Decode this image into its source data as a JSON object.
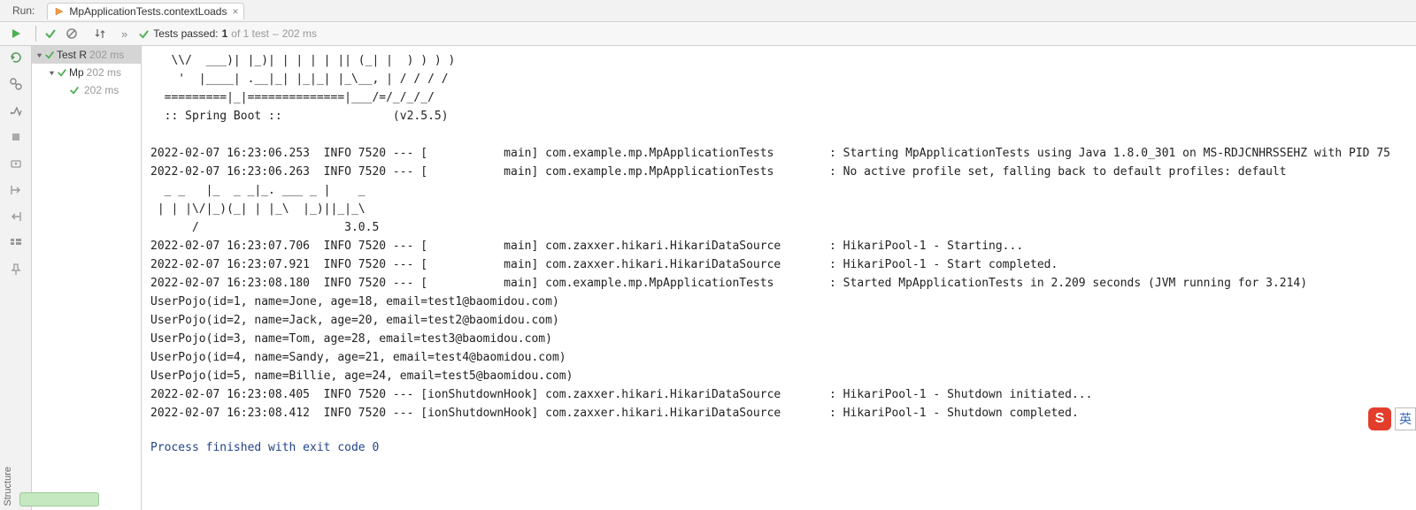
{
  "topbar": {
    "run_label": "Run:",
    "tab": {
      "label": "MpApplicationTests.contextLoads"
    }
  },
  "toolbar": {
    "status_prefix": "Tests passed:",
    "status_count": "1",
    "status_total": "of 1 test",
    "status_sep": "–",
    "status_time": "202 ms"
  },
  "tree": {
    "items": [
      {
        "name": "Test R",
        "time": "202 ms",
        "depth": 0,
        "chev": true,
        "selected": true
      },
      {
        "name": "Mp",
        "time": "202 ms",
        "depth": 1,
        "chev": true,
        "selected": false
      },
      {
        "name": "",
        "time": "202 ms",
        "depth": 2,
        "chev": false,
        "selected": false
      }
    ]
  },
  "ime": {
    "badge": "S",
    "lang": "英"
  },
  "exit_text": "Process finished with exit code 0",
  "console_lines": [
    "   \\\\/  ___)| |_)| | | | | || (_| |  ) ) ) )",
    "    '  |____| .__|_| |_|_| |_\\__, | / / / /",
    "  =========|_|==============|___/=/_/_/_/",
    "  :: Spring Boot ::                (v2.5.5)",
    "",
    "2022-02-07 16:23:06.253  INFO 7520 --- [           main] com.example.mp.MpApplicationTests        : Starting MpApplicationTests using Java 1.8.0_301 on MS-RDJCNHRSSEHZ with PID 75",
    "2022-02-07 16:23:06.263  INFO 7520 --- [           main] com.example.mp.MpApplicationTests        : No active profile set, falling back to default profiles: default",
    "  _ _   |_  _ _|_. ___ _ |    _",
    " | | |\\/|_)(_| | |_\\  |_)||_|_\\",
    "      /                     3.0.5",
    "2022-02-07 16:23:07.706  INFO 7520 --- [           main] com.zaxxer.hikari.HikariDataSource       : HikariPool-1 - Starting...",
    "2022-02-07 16:23:07.921  INFO 7520 --- [           main] com.zaxxer.hikari.HikariDataSource       : HikariPool-1 - Start completed.",
    "2022-02-07 16:23:08.180  INFO 7520 --- [           main] com.example.mp.MpApplicationTests        : Started MpApplicationTests in 2.209 seconds (JVM running for 3.214)",
    "UserPojo(id=1, name=Jone, age=18, email=test1@baomidou.com)",
    "UserPojo(id=2, name=Jack, age=20, email=test2@baomidou.com)",
    "UserPojo(id=3, name=Tom, age=28, email=test3@baomidou.com)",
    "UserPojo(id=4, name=Sandy, age=21, email=test4@baomidou.com)",
    "UserPojo(id=5, name=Billie, age=24, email=test5@baomidou.com)",
    "2022-02-07 16:23:08.405  INFO 7520 --- [ionShutdownHook] com.zaxxer.hikari.HikariDataSource       : HikariPool-1 - Shutdown initiated...",
    "2022-02-07 16:23:08.412  INFO 7520 --- [ionShutdownHook] com.zaxxer.hikari.HikariDataSource       : HikariPool-1 - Shutdown completed."
  ]
}
